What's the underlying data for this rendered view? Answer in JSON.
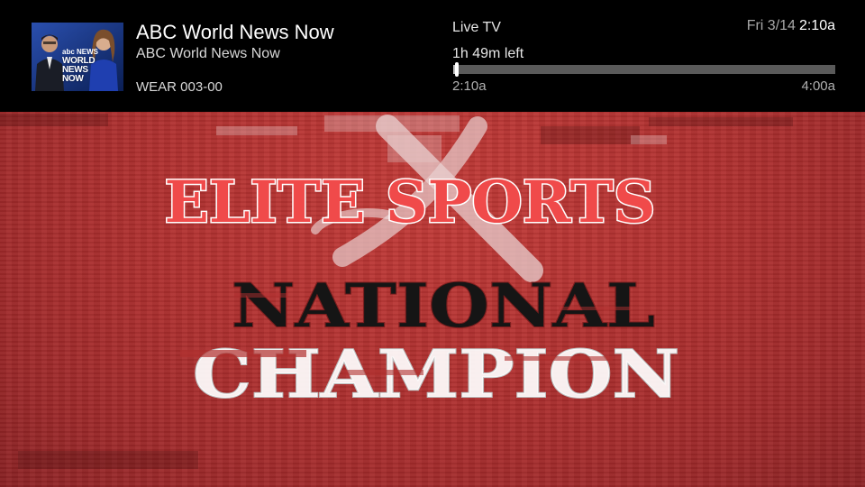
{
  "banner": {
    "program_title": "ABC World News Now",
    "program_subtitle": "ABC World News Now",
    "channel": "WEAR 003-00",
    "live_label": "Live TV",
    "time_left": "1h 49m left",
    "start_time": "2:10a",
    "end_time": "4:00a",
    "progress_fraction": 0.01,
    "clock": {
      "date": "Fri 3/14",
      "time": "2:10a"
    },
    "thumbnail": {
      "logo_small": "abc NEWS",
      "logo_lines": [
        "WORLD",
        "NEWS",
        "NOW"
      ]
    }
  },
  "video": {
    "lines": [
      "ELITE SPORTS",
      "NATIONAL",
      "CHAMPION"
    ]
  },
  "colors": {
    "banner_background": "#000000",
    "video_red": "#b1302f",
    "accent_text_red": "#f04a4a",
    "progress_track": "#5a5a5a",
    "progress_fill": "#bdbdbd"
  }
}
